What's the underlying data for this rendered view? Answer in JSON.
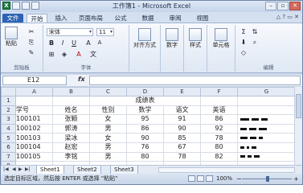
{
  "window": {
    "title": "工作簿1 - Microsoft Excel",
    "controls": [
      "–",
      "▫",
      "✕"
    ]
  },
  "tabs": [
    {
      "label": "文件",
      "kind": "file"
    },
    {
      "label": "开始",
      "kind": "active"
    },
    {
      "label": "插入"
    },
    {
      "label": "页面布局"
    },
    {
      "label": "公式"
    },
    {
      "label": "数据"
    },
    {
      "label": "审阅"
    },
    {
      "label": "视图"
    }
  ],
  "ribbon": {
    "paste_label": "粘贴",
    "font_name": "宋体",
    "font_size": "11",
    "bold": "B",
    "italic": "I",
    "underline": "U",
    "font_grow": "A",
    "font_shrink": "A",
    "wen": "文",
    "align_label": "对齐方式",
    "number_label": "数字",
    "style_label": "样式",
    "cells_label": "单元格",
    "edit_sigma": "Σ",
    "clipboard_group": "剪贴板",
    "font_group": "字体",
    "edit_group": "编辑"
  },
  "formula_bar": {
    "name_box": "E12",
    "fx": "fx",
    "value": ""
  },
  "sheet": {
    "columns": [
      "A",
      "B",
      "C",
      "D",
      "E",
      "F",
      "G"
    ],
    "rows": [
      {
        "n": "1",
        "cells": [
          "",
          "",
          "成绩表",
          "",
          "",
          "",
          ""
        ]
      },
      {
        "n": "2",
        "cells": [
          "学号",
          "姓名",
          "性别",
          "数学",
          "语文",
          "英语",
          ""
        ]
      },
      {
        "n": "3",
        "cells": [
          "100101",
          "张颖",
          "女",
          "95",
          "91",
          "86",
          ""
        ]
      },
      {
        "n": "4",
        "cells": [
          "100102",
          "郭涛",
          "男",
          "86",
          "90",
          "92",
          ""
        ]
      },
      {
        "n": "5",
        "cells": [
          "100103",
          "梁冰",
          "女",
          "90",
          "85",
          "78",
          ""
        ]
      },
      {
        "n": "6",
        "cells": [
          "100104",
          "赵宏",
          "男",
          "76",
          "67",
          "80",
          ""
        ]
      },
      {
        "n": "7",
        "cells": [
          "100105",
          "李铭",
          "男",
          "80",
          "78",
          "82",
          ""
        ]
      },
      {
        "n": "8",
        "cells": [
          "",
          "",
          "",
          "",
          "",
          "",
          ""
        ]
      }
    ],
    "sparkline_scores": [
      [
        95,
        91,
        86
      ],
      [
        86,
        90,
        92
      ],
      [
        90,
        85,
        78
      ],
      [
        76,
        67,
        80
      ],
      [
        80,
        78,
        82
      ]
    ]
  },
  "sheet_tabs": [
    "Sheet1",
    "Sheet2",
    "Sheet3"
  ],
  "status": {
    "message": "选定目标区域，然后按 ENTER 或选择 \"粘贴\"",
    "zoom": "100%",
    "minus": "−",
    "plus": "+"
  }
}
